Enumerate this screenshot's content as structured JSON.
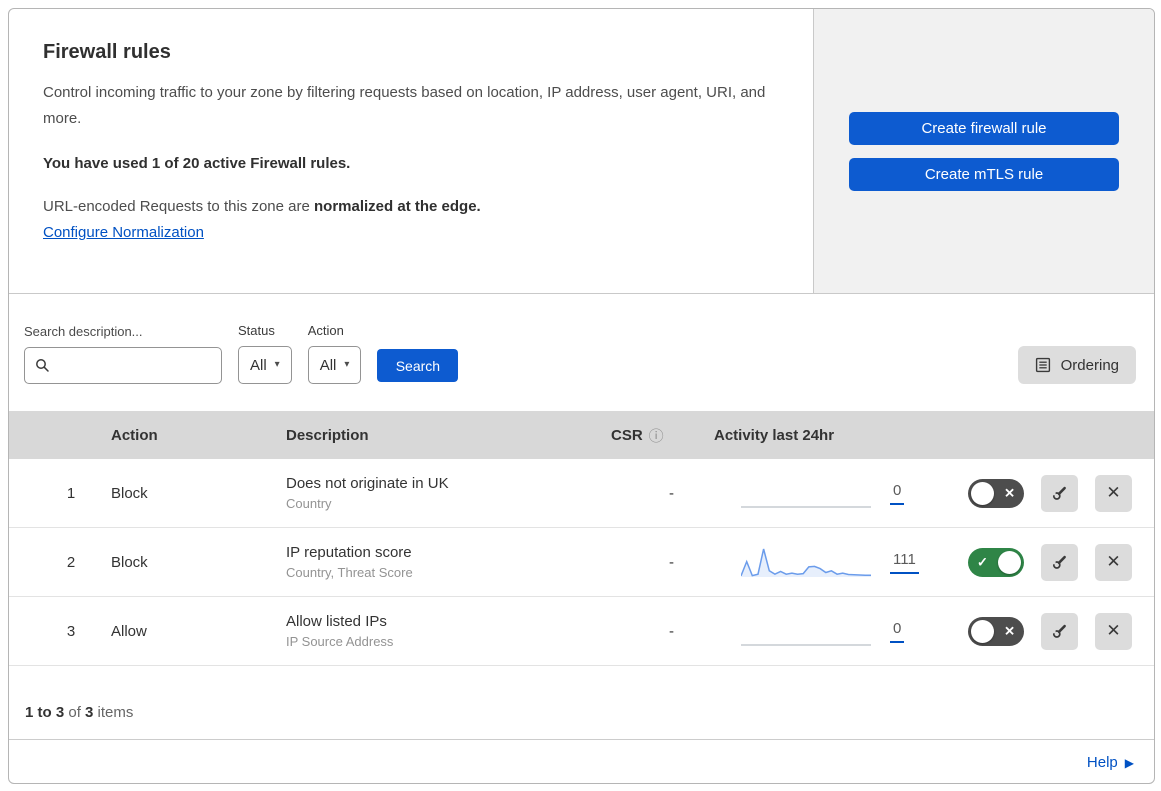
{
  "header": {
    "title": "Firewall rules",
    "description": "Control incoming traffic to your zone by filtering requests based on location, IP address, user agent, URI, and more.",
    "usage_notice": "You have used 1 of 20 active Firewall rules.",
    "normalization_prefix": "URL-encoded Requests to this zone are ",
    "normalization_bold": "normalized at the edge.",
    "normalization_link": "Configure Normalization",
    "create_firewall_button": "Create firewall rule",
    "create_mtls_button": "Create mTLS rule"
  },
  "filters": {
    "search_label": "Search description...",
    "search_value": "",
    "status_label": "Status",
    "status_value": "All",
    "action_label": "Action",
    "action_value": "All",
    "search_button": "Search",
    "ordering_button": "Ordering"
  },
  "table": {
    "columns": {
      "action": "Action",
      "description": "Description",
      "csr": "CSR",
      "activity": "Activity last 24hr"
    },
    "rows": [
      {
        "priority": "1",
        "action": "Block",
        "title": "Does not originate in UK",
        "subtitle": "Country",
        "csr": "-",
        "activity_count": "0",
        "enabled": false,
        "sparkline": [
          0,
          0,
          0,
          0,
          0,
          0,
          0,
          0,
          0,
          0,
          0,
          0,
          0,
          0,
          0,
          0,
          0,
          0,
          0,
          0,
          0,
          0,
          0,
          0
        ]
      },
      {
        "priority": "2",
        "action": "Block",
        "title": "IP reputation score",
        "subtitle": "Country, Threat Score",
        "csr": "-",
        "activity_count": "111",
        "enabled": true,
        "sparkline": [
          4,
          55,
          5,
          10,
          100,
          22,
          10,
          20,
          10,
          14,
          10,
          12,
          36,
          38,
          30,
          16,
          22,
          10,
          14,
          9,
          8,
          7,
          6,
          6
        ]
      },
      {
        "priority": "3",
        "action": "Allow",
        "title": "Allow listed IPs",
        "subtitle": "IP Source Address",
        "csr": "-",
        "activity_count": "0",
        "enabled": false,
        "sparkline": [
          0,
          0,
          0,
          0,
          0,
          0,
          0,
          0,
          0,
          0,
          0,
          0,
          0,
          0,
          0,
          0,
          0,
          0,
          0,
          0,
          0,
          0,
          0,
          0
        ]
      }
    ]
  },
  "footer": {
    "range": "1 to 3",
    "of": " of ",
    "total": "3",
    "items": " items",
    "help": "Help"
  },
  "icons": {
    "caret": "▾",
    "info": "ⓘ",
    "close": "✕",
    "check": "✓",
    "help_arrow": "▶"
  },
  "colors": {
    "accent_blue": "#0d5bd0",
    "link_blue": "#0051c3",
    "toggle_on_green": "#2f8547",
    "toggle_off_gray": "#4d4d4d",
    "spark_line_blue": "#6b9ceb",
    "spark_fill_blue": "rgba(107,156,235,0.16)",
    "spark_flat_gray": "#c6cbd1",
    "table_header_gray": "#d8d8d8",
    "panel_gray": "#f1f1f1"
  }
}
